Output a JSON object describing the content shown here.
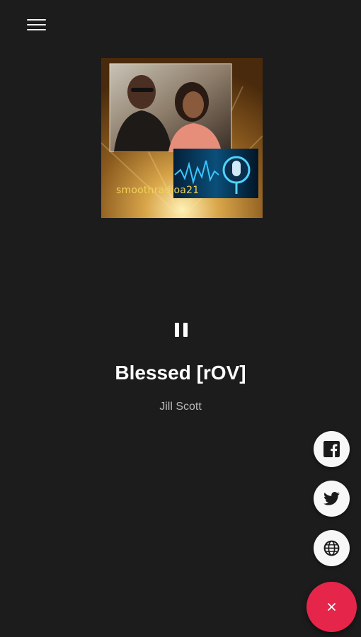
{
  "header": {
    "menu_icon": "hamburger-menu-icon"
  },
  "artwork": {
    "caption": "smoothradioa21"
  },
  "player": {
    "state": "playing",
    "control_icon": "pause-icon",
    "track_title": "Blessed [rOV]",
    "artist": "Jill Scott"
  },
  "share": {
    "items": [
      {
        "icon": "facebook-icon"
      },
      {
        "icon": "twitter-icon"
      },
      {
        "icon": "globe-icon"
      }
    ],
    "close_icon": "close-icon"
  },
  "colors": {
    "background": "#1c1c1d",
    "accent": "#e5254a",
    "fab_background": "#f7f7f7",
    "artist_text": "#b9b9b9"
  }
}
